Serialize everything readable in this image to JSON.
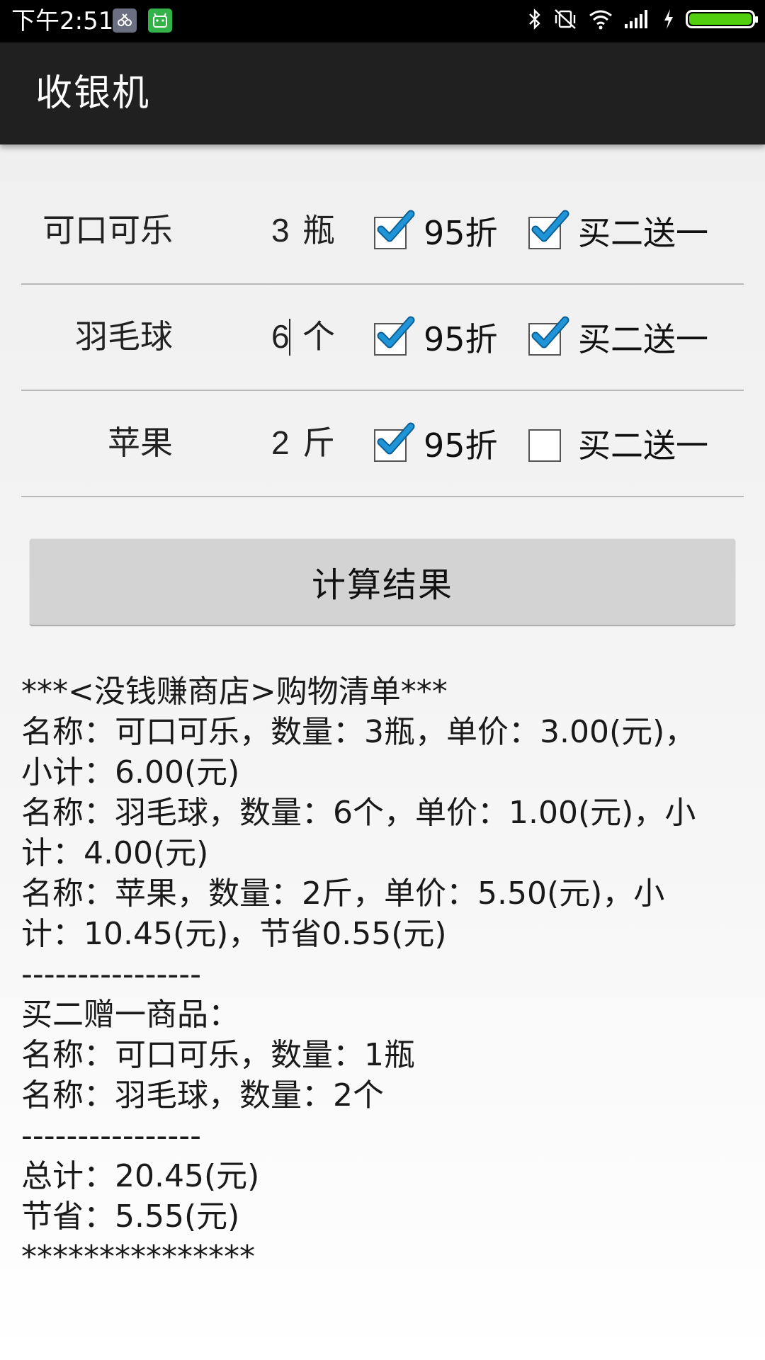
{
  "status_bar": {
    "time": "下午2:51"
  },
  "app": {
    "title": "收银机"
  },
  "products": [
    {
      "name": "可口可乐",
      "quantity": "3",
      "unit": "瓶",
      "discount_label": "95折",
      "discount_checked": true,
      "promo_label": "买二送一",
      "promo_checked": true
    },
    {
      "name": "羽毛球",
      "quantity": "6",
      "unit": "个",
      "discount_label": "95折",
      "discount_checked": true,
      "promo_label": "买二送一",
      "promo_checked": true
    },
    {
      "name": "苹果",
      "quantity": "2",
      "unit": "斤",
      "discount_label": "95折",
      "discount_checked": true,
      "promo_label": "买二送一",
      "promo_checked": false
    }
  ],
  "calc_button": "计算结果",
  "receipt": {
    "lines": [
      "***<没钱赚商店>购物清单***",
      "名称：可口可乐，数量：3瓶，单价：3.00(元)，",
      "小计：6.00(元)",
      "名称：羽毛球，数量：6个，单价：1.00(元)，小",
      "计：4.00(元)",
      "名称：苹果，数量：2斤，单价：5.50(元)，小",
      "计：10.45(元)，节省0.55(元)",
      "----------------",
      "买二赠一商品：",
      "名称：可口可乐，数量：1瓶",
      "名称：羽毛球，数量：2个",
      "----------------",
      "总计：20.45(元)",
      "节省：5.55(元)",
      "***************"
    ]
  },
  "colors": {
    "check": "#1f95d8",
    "battery": "#52d00f",
    "action_bar": "#202020"
  }
}
